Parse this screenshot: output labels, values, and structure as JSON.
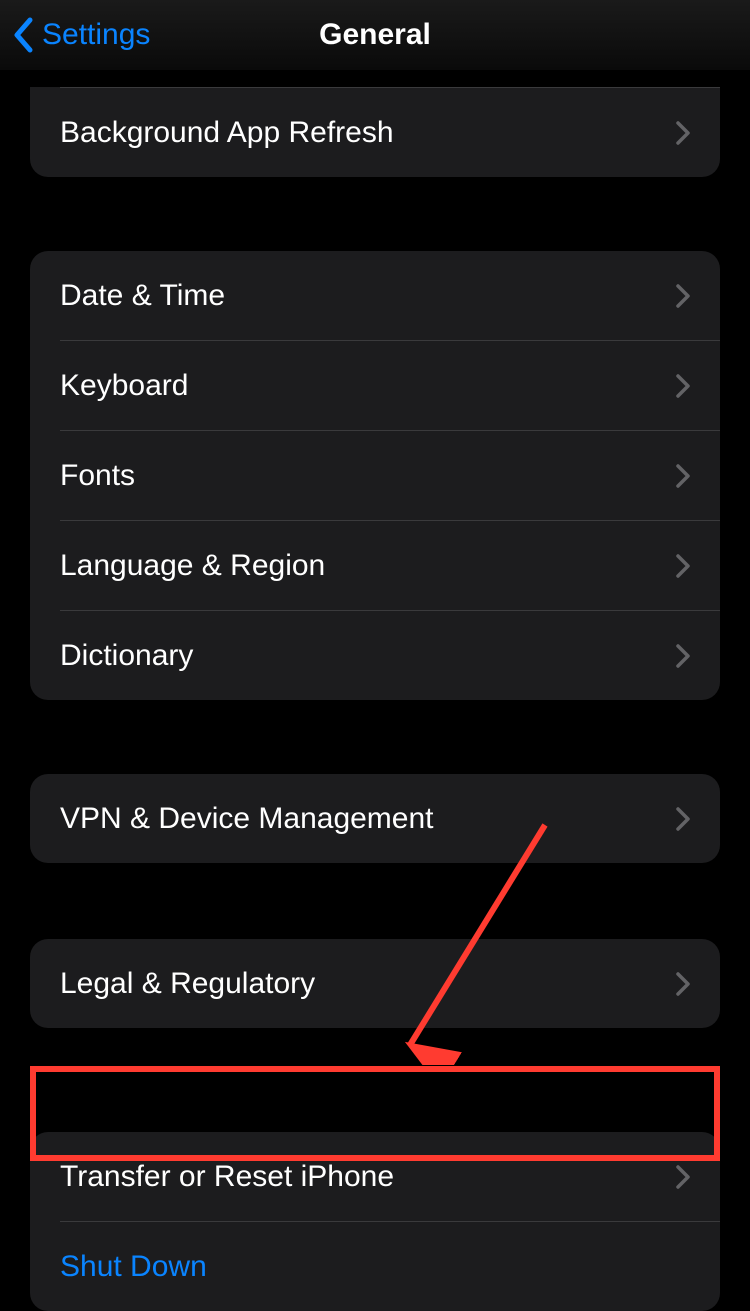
{
  "nav": {
    "back_label": "Settings",
    "title": "General"
  },
  "groups": {
    "g0": {
      "background_app_refresh": "Background App Refresh"
    },
    "g1": {
      "date_time": "Date & Time",
      "keyboard": "Keyboard",
      "fonts": "Fonts",
      "language_region": "Language & Region",
      "dictionary": "Dictionary"
    },
    "g2": {
      "vpn_device": "VPN & Device Management"
    },
    "g3": {
      "legal": "Legal & Regulatory"
    },
    "g4": {
      "transfer_reset": "Transfer or Reset iPhone",
      "shut_down": "Shut Down"
    }
  },
  "colors": {
    "accent": "#0a84ff",
    "annotation": "#ff3b30"
  }
}
